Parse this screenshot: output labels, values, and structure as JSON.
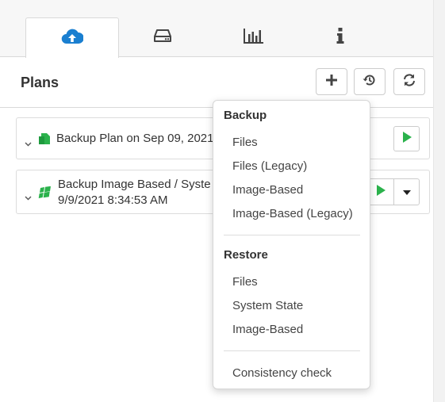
{
  "tabs": [
    {
      "icon": "cloud-upload-icon",
      "active": true
    },
    {
      "icon": "hard-drive-icon",
      "active": false
    },
    {
      "icon": "bar-chart-icon",
      "active": false
    },
    {
      "icon": "info-icon",
      "active": false
    }
  ],
  "header": {
    "title": "Plans"
  },
  "toolbar": {
    "add": "plus-icon",
    "history": "history-icon",
    "refresh": "refresh-icon"
  },
  "plans": [
    {
      "name": "Backup Plan on Sep 09, 2021",
      "icon": "file-backup-icon",
      "icon_color": "#2bb24c"
    },
    {
      "name": "Backup Image Based / Syste",
      "date": "9/9/2021 8:34:53 AM",
      "icon": "windows-icon",
      "icon_color": "#2bb24c"
    }
  ],
  "menu": {
    "backup_heading": "Backup",
    "backup_items": [
      "Files",
      "Files (Legacy)",
      "Image-Based",
      "Image-Based (Legacy)"
    ],
    "restore_heading": "Restore",
    "restore_items": [
      "Files",
      "System State",
      "Image-Based"
    ],
    "consistency": "Consistency check"
  },
  "colors": {
    "accent": "#1a7fd0",
    "play": "#2bb24c"
  }
}
